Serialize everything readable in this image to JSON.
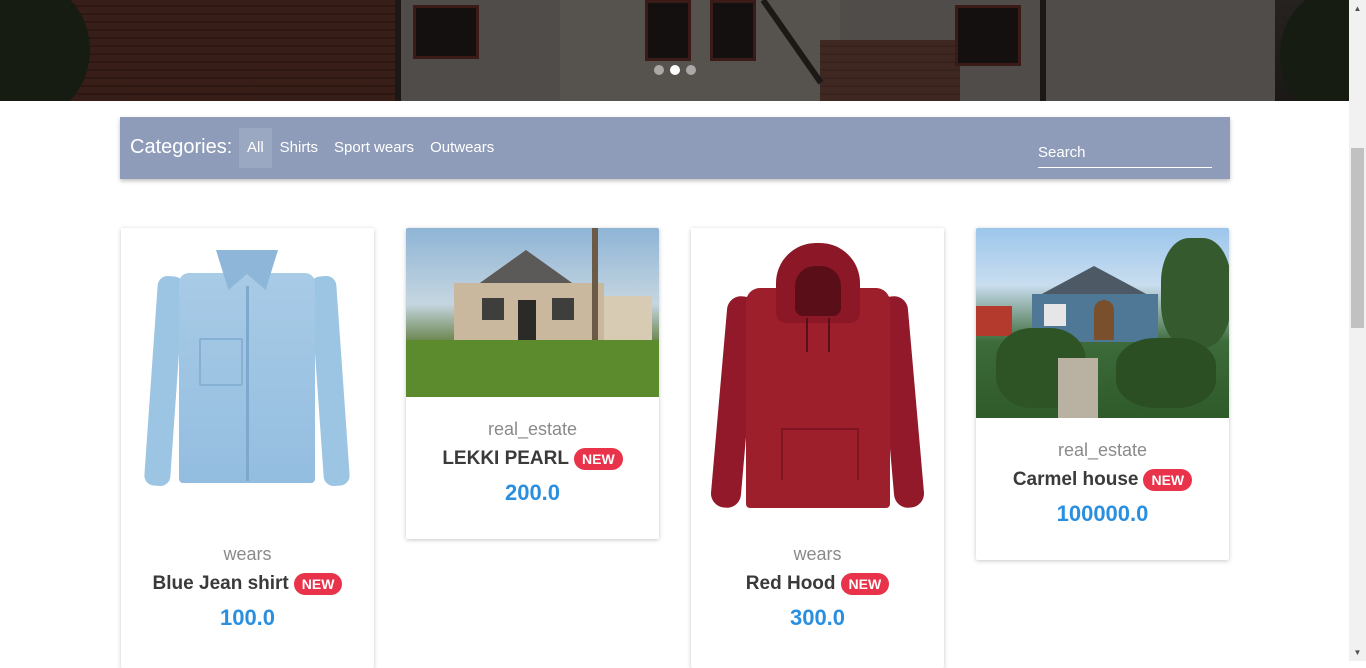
{
  "hero": {
    "carousel_dots": [
      false,
      true,
      false
    ]
  },
  "categories": {
    "label": "Categories:",
    "tabs": [
      {
        "label": "All",
        "active": true
      },
      {
        "label": "Shirts",
        "active": false
      },
      {
        "label": "Sport wears",
        "active": false
      },
      {
        "label": "Outwears",
        "active": false
      }
    ],
    "search_placeholder": "Search"
  },
  "products": [
    {
      "category": "wears",
      "title": "Blue Jean shirt",
      "badge": "NEW",
      "price": "100.0",
      "image": "blue-denim-shirt"
    },
    {
      "category": "real_estate",
      "title": "LEKKI PEARL",
      "badge": "NEW",
      "price": "200.0",
      "image": "house-with-lawn"
    },
    {
      "category": "wears",
      "title": "Red Hood",
      "badge": "NEW",
      "price": "300.0",
      "image": "red-hoodie"
    },
    {
      "category": "real_estate",
      "title": "Carmel house",
      "badge": "NEW",
      "price": "100000.0",
      "image": "blue-cottage"
    }
  ],
  "colors": {
    "category_bar": "#8e9cb9",
    "badge": "#e8334a",
    "price": "#2b8fe0"
  }
}
